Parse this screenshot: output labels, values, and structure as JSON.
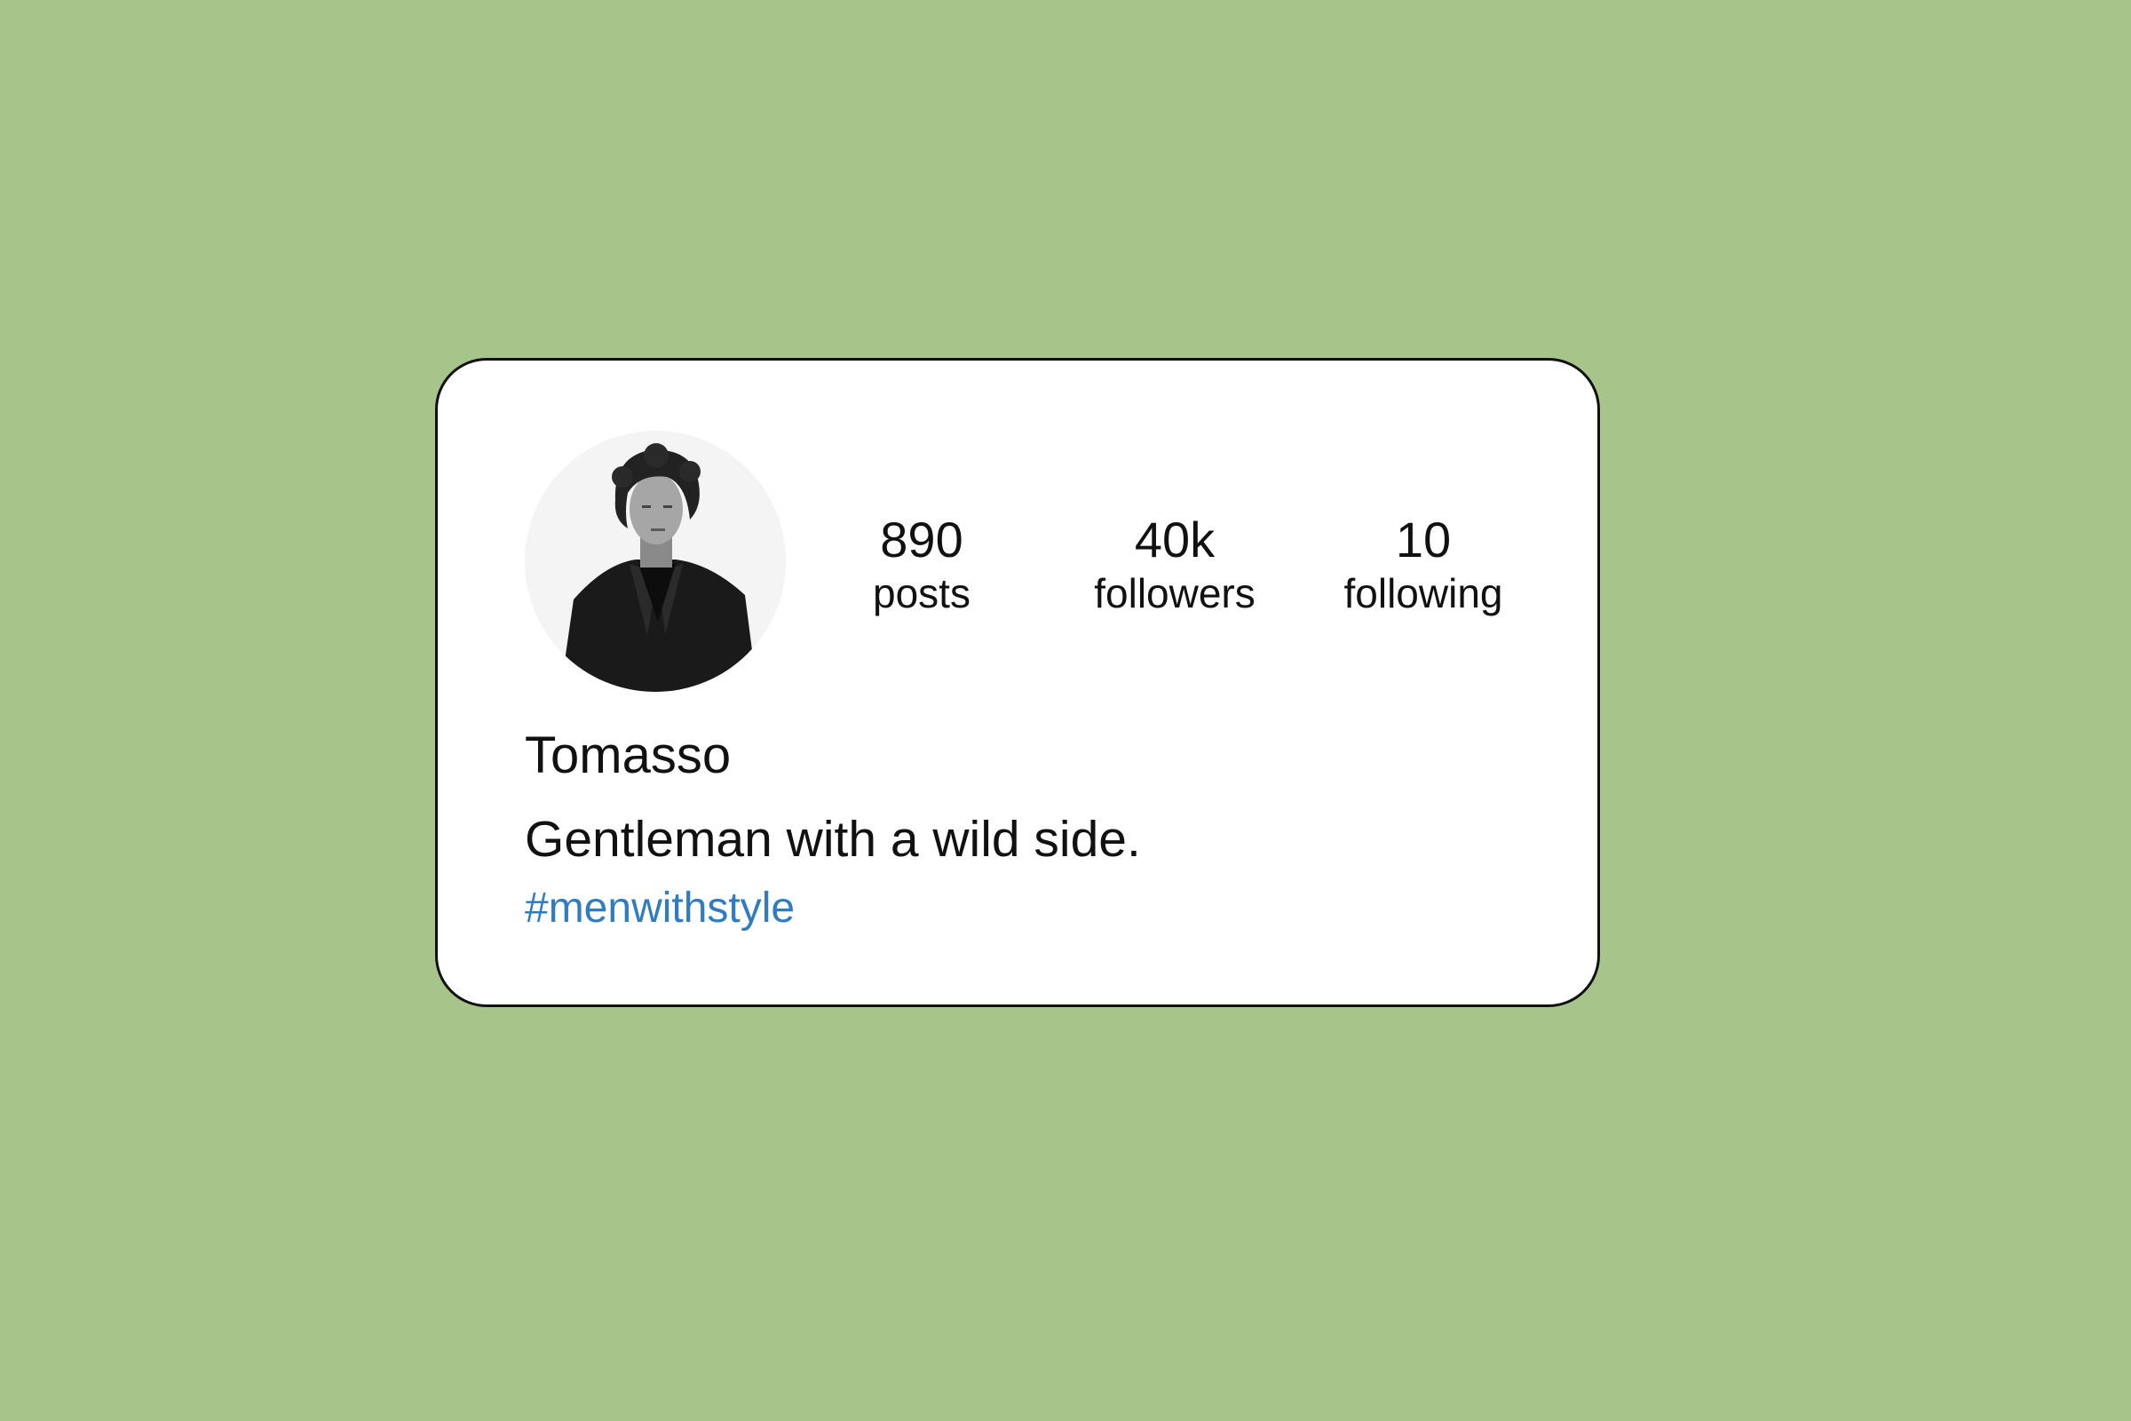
{
  "profile": {
    "name": "Tomasso",
    "bio": "Gentleman with a wild side.",
    "hashtag": "#menwithstyle",
    "avatar_icon": "profile-photo"
  },
  "stats": {
    "posts": {
      "value": "890",
      "label": "posts"
    },
    "followers": {
      "value": "40k",
      "label": "followers"
    },
    "following": {
      "value": "10",
      "label": "following"
    }
  },
  "colors": {
    "background": "#a7c48a",
    "card": "#ffffff",
    "text": "#111111",
    "hashtag": "#2f7cc3"
  }
}
